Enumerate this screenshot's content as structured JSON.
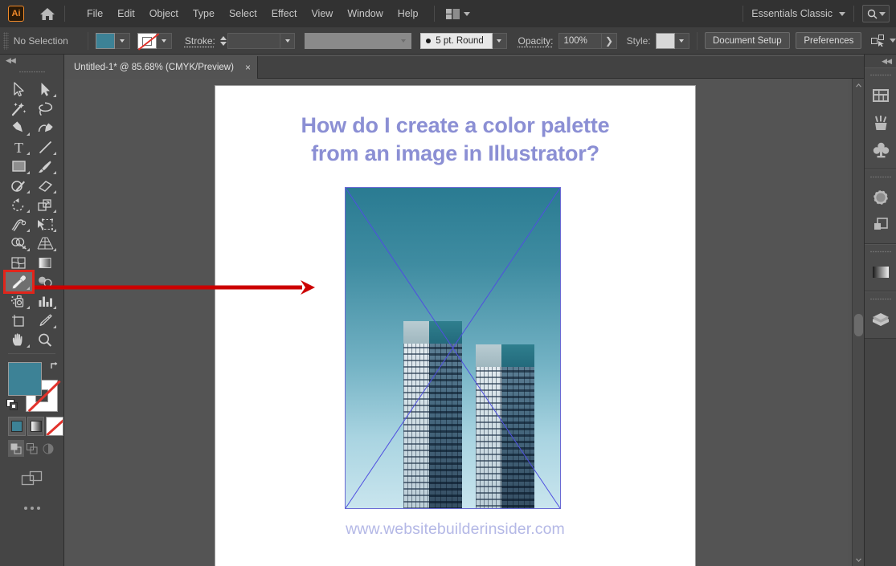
{
  "app": {
    "name": "Adobe Illustrator",
    "logo_text": "Ai",
    "accent_color": "#f08a2a"
  },
  "menubar": {
    "home_icon": "home-icon",
    "items": [
      "File",
      "Edit",
      "Object",
      "Type",
      "Select",
      "Effect",
      "View",
      "Window",
      "Help"
    ],
    "arrange_icon": "arrange-documents-icon",
    "workspace": "Essentials Classic",
    "workspace_chevron": "chevron-down-icon",
    "search_icon": "search-icon"
  },
  "controlbar": {
    "selection_status": "No Selection",
    "fill_color": "#3d8296",
    "fill_label": "Fill",
    "stroke_color": "None",
    "stroke_label": "Stroke:",
    "stroke_weight": "",
    "stroke_profile": "",
    "brush_definition": "5 pt. Round",
    "opacity_label": "Opacity:",
    "opacity_value": "100%",
    "style_label": "Style:",
    "style_swatch": "#d8d8d8",
    "document_setup": "Document Setup",
    "preferences": "Preferences",
    "align_icon": "align-to-selection-icon"
  },
  "tabbar": {
    "document_title": "Untitled-1* @ 85.68% (CMYK/Preview)",
    "close_icon": "×"
  },
  "toolbar": {
    "collapse_icon": "◀◀",
    "tools": [
      {
        "name": "selection-tool",
        "has_flyout": false
      },
      {
        "name": "direct-selection-tool",
        "has_flyout": true
      },
      {
        "name": "magic-wand-tool",
        "has_flyout": false
      },
      {
        "name": "lasso-tool",
        "has_flyout": false
      },
      {
        "name": "pen-tool",
        "has_flyout": true
      },
      {
        "name": "curvature-tool",
        "has_flyout": false
      },
      {
        "name": "type-tool",
        "has_flyout": true
      },
      {
        "name": "line-segment-tool",
        "has_flyout": true
      },
      {
        "name": "rectangle-tool",
        "has_flyout": true
      },
      {
        "name": "paintbrush-tool",
        "has_flyout": true
      },
      {
        "name": "shaper-tool",
        "has_flyout": true
      },
      {
        "name": "eraser-tool",
        "has_flyout": true
      },
      {
        "name": "rotate-tool",
        "has_flyout": true
      },
      {
        "name": "scale-tool",
        "has_flyout": true
      },
      {
        "name": "width-tool",
        "has_flyout": true
      },
      {
        "name": "free-transform-tool",
        "has_flyout": true
      },
      {
        "name": "shape-builder-tool",
        "has_flyout": true
      },
      {
        "name": "perspective-grid-tool",
        "has_flyout": true
      },
      {
        "name": "mesh-tool",
        "has_flyout": false
      },
      {
        "name": "gradient-tool",
        "has_flyout": false
      },
      {
        "name": "eyedropper-tool",
        "has_flyout": true,
        "selected": true
      },
      {
        "name": "blend-tool",
        "has_flyout": false
      },
      {
        "name": "symbol-sprayer-tool",
        "has_flyout": true
      },
      {
        "name": "column-graph-tool",
        "has_flyout": true
      },
      {
        "name": "artboard-tool",
        "has_flyout": false
      },
      {
        "name": "slice-tool",
        "has_flyout": true
      },
      {
        "name": "hand-tool",
        "has_flyout": true
      },
      {
        "name": "zoom-tool",
        "has_flyout": false
      }
    ],
    "fill_swatch_color": "#3d8296",
    "stroke_swatch_color": "None",
    "swap_icon": "swap-fill-stroke-icon",
    "default_icon": "default-fill-stroke-icon",
    "color_modes": [
      "color-swatch-mode",
      "gradient-mode",
      "none-mode"
    ],
    "draw_modes": [
      "draw-normal",
      "draw-behind",
      "draw-inside"
    ],
    "screen_mode_icon": "change-screen-mode-icon",
    "more_tools_icon": "edit-toolbar-icon"
  },
  "artboard": {
    "heading_line1": "How do I create a color palette",
    "heading_line2": "from an image in Illustrator?",
    "heading_color": "#8b8fd4",
    "footer_url": "www.websitebuilderinsider.com",
    "footer_color": "#b4b8e6",
    "placed_image": {
      "name": "skyscrapers-photo",
      "description": "Two modern high-rise towers against a teal-to-pale-blue sky gradient",
      "sky_top_color": "#2a7b92",
      "sky_bottom_color": "#c9e5ee",
      "link_indicator": "placed-image-x-cross",
      "link_color": "#4f4fe0"
    }
  },
  "annotation": {
    "name": "red-arrow-to-eyedropper",
    "color": "#cc0000",
    "highlight_target": "eyedropper-tool"
  },
  "scrollbar": {
    "vertical_up_icon": "scroll-up-icon",
    "vertical_down_icon": "scroll-down-icon",
    "thumb": "vertical-scroll-thumb"
  },
  "rightdock": {
    "collapse_icon": "◀◀",
    "groups": [
      {
        "items": [
          "properties-panel-icon",
          "brushes-panel-icon",
          "symbols-panel-icon"
        ]
      },
      {
        "items": [
          "stroke-panel-icon",
          "transparency-panel-icon"
        ]
      },
      {
        "items": [
          "gradient-panel-icon"
        ]
      },
      {
        "items": [
          "layers-panel-icon"
        ]
      }
    ]
  }
}
